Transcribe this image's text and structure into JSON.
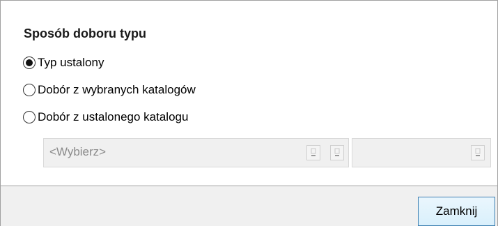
{
  "group": {
    "title": "Sposób doboru typu",
    "options": [
      {
        "label": "Typ ustalony",
        "selected": true
      },
      {
        "label": "Dobór z wybranych katalogów",
        "selected": false
      },
      {
        "label": "Dobór z ustalonego katalogu",
        "selected": false
      }
    ]
  },
  "catalog_select": {
    "placeholder": "<Wybierz>",
    "secondary_value": ""
  },
  "footer": {
    "close_label": "Zamknij"
  },
  "colors": {
    "panel_background": "#ffffff",
    "dialog_background": "#f0f0f0",
    "button_border": "#3c7fb1",
    "disabled_text": "#8a8a8a"
  }
}
